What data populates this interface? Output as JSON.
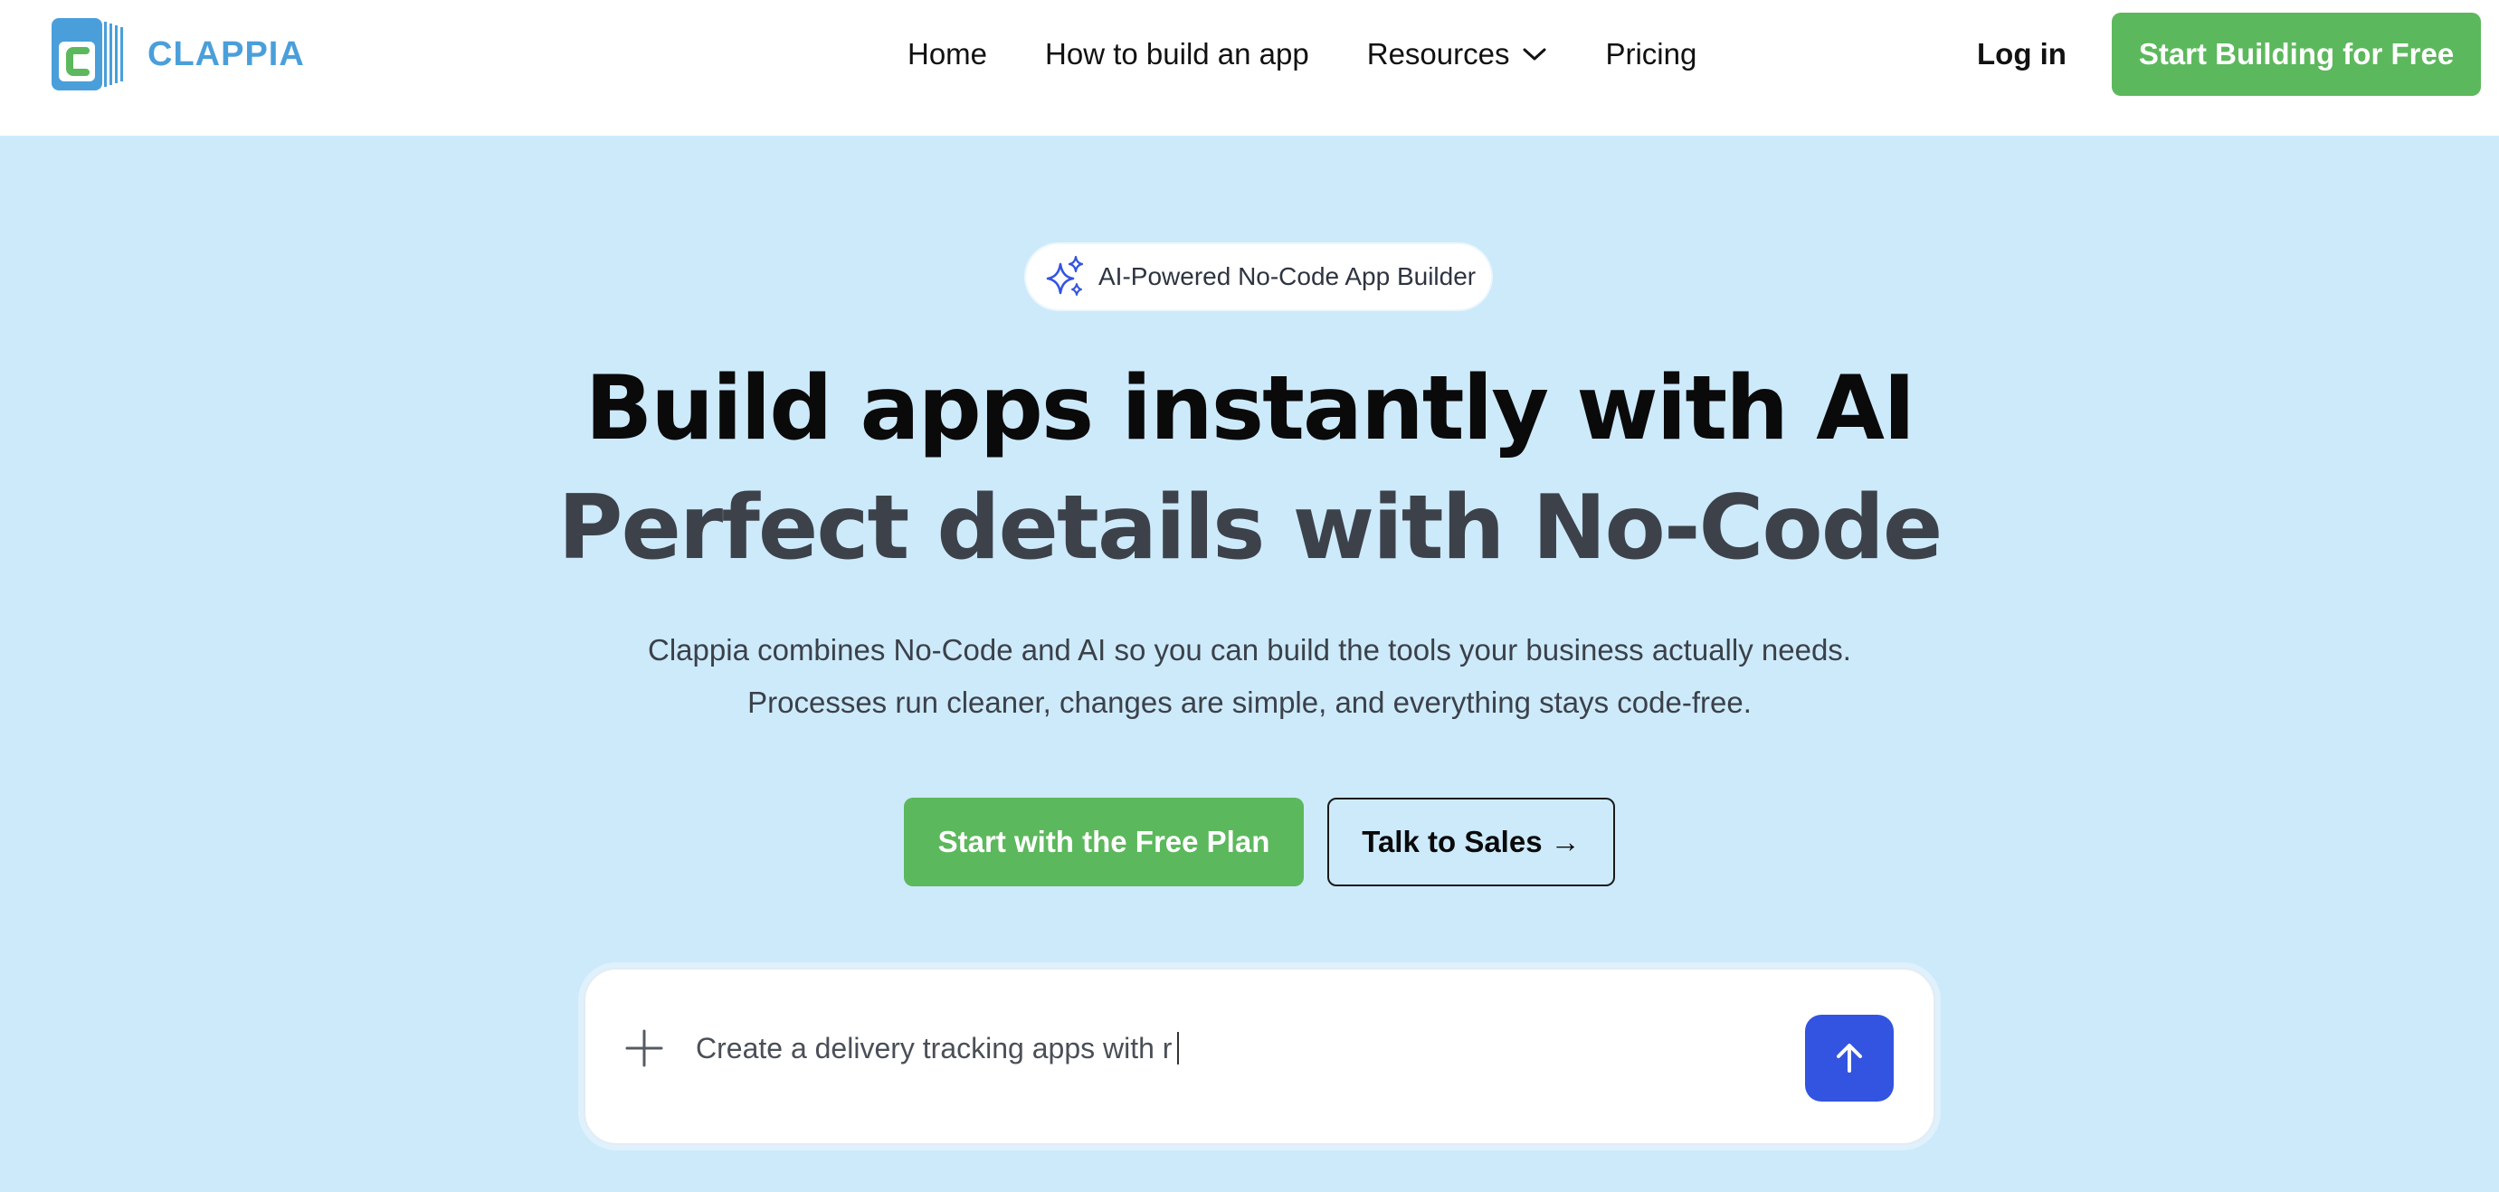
{
  "header": {
    "brand_name": "CLAPPIA",
    "nav": [
      {
        "label": "Home"
      },
      {
        "label": "How to build an app"
      },
      {
        "label": "Resources",
        "has_dropdown": true
      },
      {
        "label": "Pricing"
      }
    ],
    "login_label": "Log in",
    "cta_label": "Start Building for Free"
  },
  "hero": {
    "badge_text": "AI-Powered No-Code App Builder",
    "headline_line1": "Build apps instantly with AI",
    "headline_line2": "Perfect details with No-Code",
    "subtitle_line1": "Clappia combines No-Code and AI so you can build the tools your business actually needs.",
    "subtitle_line2": "Processes run cleaner, changes are simple, and everything stays code-free.",
    "primary_button": "Start with the Free Plan",
    "secondary_button": "Talk to Sales →"
  },
  "prompt": {
    "value": "Create a delivery tracking apps with r"
  },
  "icons": {
    "logo": "clappia-logo-icon",
    "chevron": "chevron-down-icon",
    "sparkle": "sparkle-icon",
    "plus": "plus-icon",
    "send": "arrow-up-icon"
  },
  "colors": {
    "brand_blue": "#4a9fda",
    "cta_green": "#5cb85c",
    "hero_background": "#cdeafb",
    "send_button": "#3354e0"
  }
}
